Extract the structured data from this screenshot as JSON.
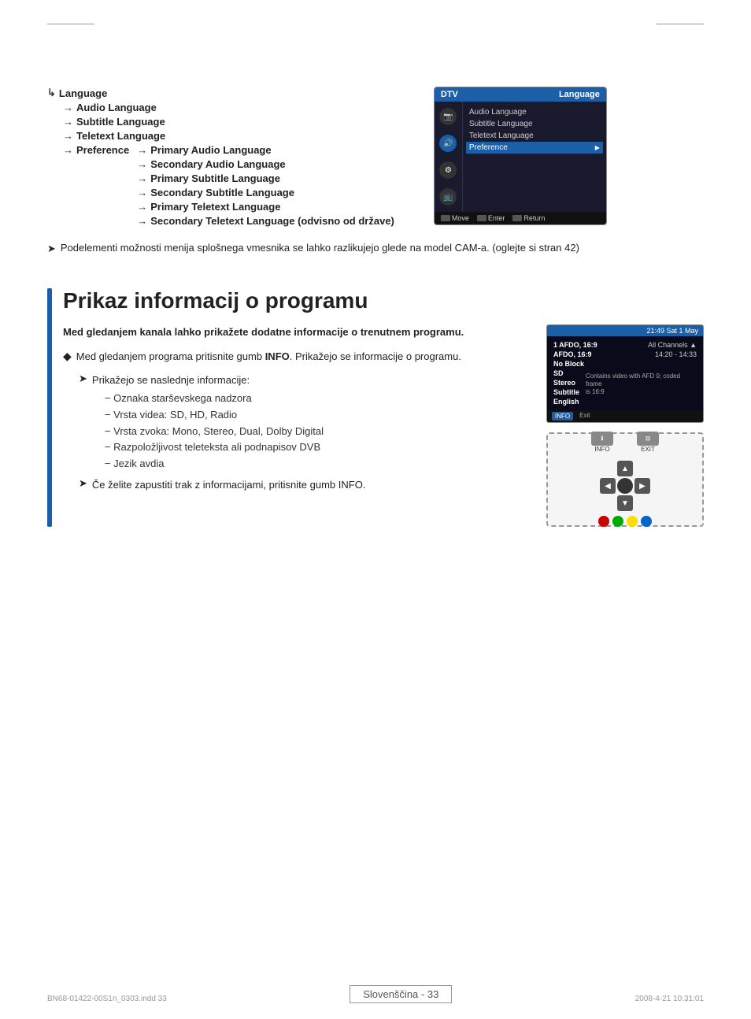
{
  "page": {
    "top_border": true,
    "page_number": "Slovenščina - 33",
    "file_info": "BN68-01422-00S1n_0303.indd    33",
    "date_info": "2008-4-21    10:31:01"
  },
  "section1": {
    "tree": {
      "level1": {
        "label": "Language",
        "children": [
          {
            "label": "Audio Language"
          },
          {
            "label": "Subtitle Language"
          },
          {
            "label": "Teletext Language"
          },
          {
            "label": "Preference",
            "children": [
              {
                "label": "Primary Audio Language"
              },
              {
                "label": "Secondary Audio Language"
              },
              {
                "label": "Primary Subtitle Language"
              },
              {
                "label": "Secondary Subtitle Language"
              },
              {
                "label": "Primary Teletext Language"
              },
              {
                "label": "Secondary Teletext Language (odvisno od države)"
              }
            ]
          }
        ]
      }
    },
    "tv_screen": {
      "header_left": "DTV",
      "header_right": "Language",
      "menu_items": [
        {
          "label": "Audio Language",
          "selected": false
        },
        {
          "label": "Subtitle Language",
          "selected": false
        },
        {
          "label": "Teletext Language",
          "selected": false
        },
        {
          "label": "Preference",
          "selected": true,
          "has_arrow": true
        }
      ],
      "footer": [
        {
          "icon": "move-icon",
          "label": "Move"
        },
        {
          "icon": "enter-icon",
          "label": "Enter"
        },
        {
          "icon": "return-icon",
          "label": "Return"
        }
      ]
    },
    "note": {
      "arrow": "➤",
      "text": "Podelementi možnosti menija splošnega vmesnika se lahko razlikujejo glede na model CAM-a. (oglejte si stran 42)"
    }
  },
  "section2": {
    "title": "Prikaz informacij o programu",
    "intro": "Med gledanjem kanala lahko prikažete dodatne informacije o trenutnem programu.",
    "bullet": {
      "symbol": "◆",
      "text1": "Med gledanjem programa pritisnite gumb ",
      "bold_text": "INFO",
      "text2": ". Prikažejo se informacije o programu."
    },
    "subnote1": {
      "arrow": "➤",
      "text": "Prikažejo se naslednje informacije:",
      "items": [
        "Oznaka starševskega nadzora",
        "Vrsta videa: SD, HD, Radio",
        "Vrsta zvoka: Mono, Stereo, Dual, Dolby Digital",
        "Razpoložljivost teleteksta ali podnapisov DVB",
        "Jezik avdia"
      ]
    },
    "subnote2": {
      "arrow": "➤",
      "text1": "Če želite zapustiti trak z informacijami, pritisnite gumb ",
      "bold_text": "INFO",
      "text2": "."
    },
    "tv_info_screen": {
      "header": "21:49 Sat 1 May",
      "rows": [
        {
          "left": "1 AFDO, 16:9",
          "right": "All Channels  ▲"
        },
        {
          "left": "AFDO, 16:9",
          "right": "14:20 - 14:33"
        },
        {
          "left": "No Block",
          "right": ""
        },
        {
          "left": "SD",
          "right": "Contains video with AFD 0; coded frame"
        },
        {
          "left": "Stereo",
          "right": "is 16:9"
        },
        {
          "left": "Subtitle",
          "right": ""
        },
        {
          "left": "English",
          "right": ""
        }
      ],
      "footer_btn": "INFO",
      "footer_label": "Exit"
    },
    "remote_control": {
      "top_left_label": "INFO",
      "top_right_label": "EXIT",
      "nav_arrows": [
        "▲",
        "◀",
        "▶",
        "▼"
      ],
      "color_buttons": [
        "red",
        "#00aa00",
        "#ffdd00",
        "#0066cc"
      ]
    }
  }
}
